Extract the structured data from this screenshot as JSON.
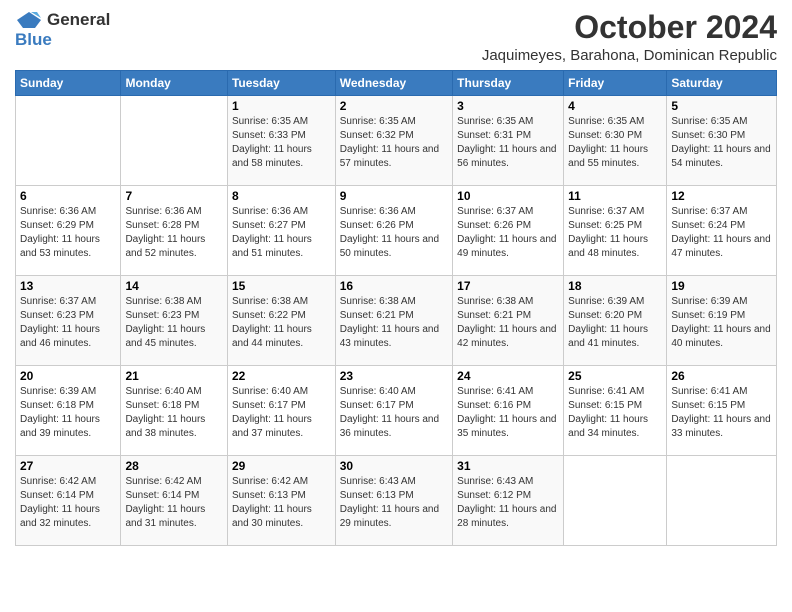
{
  "logo": {
    "general": "General",
    "blue": "Blue"
  },
  "title": {
    "month": "October 2024",
    "location": "Jaquimeyes, Barahona, Dominican Republic"
  },
  "weekdays": [
    "Sunday",
    "Monday",
    "Tuesday",
    "Wednesday",
    "Thursday",
    "Friday",
    "Saturday"
  ],
  "weeks": [
    [
      {
        "day": "",
        "sunrise": "",
        "sunset": "",
        "daylight": ""
      },
      {
        "day": "",
        "sunrise": "",
        "sunset": "",
        "daylight": ""
      },
      {
        "day": "1",
        "sunrise": "Sunrise: 6:35 AM",
        "sunset": "Sunset: 6:33 PM",
        "daylight": "Daylight: 11 hours and 58 minutes."
      },
      {
        "day": "2",
        "sunrise": "Sunrise: 6:35 AM",
        "sunset": "Sunset: 6:32 PM",
        "daylight": "Daylight: 11 hours and 57 minutes."
      },
      {
        "day": "3",
        "sunrise": "Sunrise: 6:35 AM",
        "sunset": "Sunset: 6:31 PM",
        "daylight": "Daylight: 11 hours and 56 minutes."
      },
      {
        "day": "4",
        "sunrise": "Sunrise: 6:35 AM",
        "sunset": "Sunset: 6:30 PM",
        "daylight": "Daylight: 11 hours and 55 minutes."
      },
      {
        "day": "5",
        "sunrise": "Sunrise: 6:35 AM",
        "sunset": "Sunset: 6:30 PM",
        "daylight": "Daylight: 11 hours and 54 minutes."
      }
    ],
    [
      {
        "day": "6",
        "sunrise": "Sunrise: 6:36 AM",
        "sunset": "Sunset: 6:29 PM",
        "daylight": "Daylight: 11 hours and 53 minutes."
      },
      {
        "day": "7",
        "sunrise": "Sunrise: 6:36 AM",
        "sunset": "Sunset: 6:28 PM",
        "daylight": "Daylight: 11 hours and 52 minutes."
      },
      {
        "day": "8",
        "sunrise": "Sunrise: 6:36 AM",
        "sunset": "Sunset: 6:27 PM",
        "daylight": "Daylight: 11 hours and 51 minutes."
      },
      {
        "day": "9",
        "sunrise": "Sunrise: 6:36 AM",
        "sunset": "Sunset: 6:26 PM",
        "daylight": "Daylight: 11 hours and 50 minutes."
      },
      {
        "day": "10",
        "sunrise": "Sunrise: 6:37 AM",
        "sunset": "Sunset: 6:26 PM",
        "daylight": "Daylight: 11 hours and 49 minutes."
      },
      {
        "day": "11",
        "sunrise": "Sunrise: 6:37 AM",
        "sunset": "Sunset: 6:25 PM",
        "daylight": "Daylight: 11 hours and 48 minutes."
      },
      {
        "day": "12",
        "sunrise": "Sunrise: 6:37 AM",
        "sunset": "Sunset: 6:24 PM",
        "daylight": "Daylight: 11 hours and 47 minutes."
      }
    ],
    [
      {
        "day": "13",
        "sunrise": "Sunrise: 6:37 AM",
        "sunset": "Sunset: 6:23 PM",
        "daylight": "Daylight: 11 hours and 46 minutes."
      },
      {
        "day": "14",
        "sunrise": "Sunrise: 6:38 AM",
        "sunset": "Sunset: 6:23 PM",
        "daylight": "Daylight: 11 hours and 45 minutes."
      },
      {
        "day": "15",
        "sunrise": "Sunrise: 6:38 AM",
        "sunset": "Sunset: 6:22 PM",
        "daylight": "Daylight: 11 hours and 44 minutes."
      },
      {
        "day": "16",
        "sunrise": "Sunrise: 6:38 AM",
        "sunset": "Sunset: 6:21 PM",
        "daylight": "Daylight: 11 hours and 43 minutes."
      },
      {
        "day": "17",
        "sunrise": "Sunrise: 6:38 AM",
        "sunset": "Sunset: 6:21 PM",
        "daylight": "Daylight: 11 hours and 42 minutes."
      },
      {
        "day": "18",
        "sunrise": "Sunrise: 6:39 AM",
        "sunset": "Sunset: 6:20 PM",
        "daylight": "Daylight: 11 hours and 41 minutes."
      },
      {
        "day": "19",
        "sunrise": "Sunrise: 6:39 AM",
        "sunset": "Sunset: 6:19 PM",
        "daylight": "Daylight: 11 hours and 40 minutes."
      }
    ],
    [
      {
        "day": "20",
        "sunrise": "Sunrise: 6:39 AM",
        "sunset": "Sunset: 6:18 PM",
        "daylight": "Daylight: 11 hours and 39 minutes."
      },
      {
        "day": "21",
        "sunrise": "Sunrise: 6:40 AM",
        "sunset": "Sunset: 6:18 PM",
        "daylight": "Daylight: 11 hours and 38 minutes."
      },
      {
        "day": "22",
        "sunrise": "Sunrise: 6:40 AM",
        "sunset": "Sunset: 6:17 PM",
        "daylight": "Daylight: 11 hours and 37 minutes."
      },
      {
        "day": "23",
        "sunrise": "Sunrise: 6:40 AM",
        "sunset": "Sunset: 6:17 PM",
        "daylight": "Daylight: 11 hours and 36 minutes."
      },
      {
        "day": "24",
        "sunrise": "Sunrise: 6:41 AM",
        "sunset": "Sunset: 6:16 PM",
        "daylight": "Daylight: 11 hours and 35 minutes."
      },
      {
        "day": "25",
        "sunrise": "Sunrise: 6:41 AM",
        "sunset": "Sunset: 6:15 PM",
        "daylight": "Daylight: 11 hours and 34 minutes."
      },
      {
        "day": "26",
        "sunrise": "Sunrise: 6:41 AM",
        "sunset": "Sunset: 6:15 PM",
        "daylight": "Daylight: 11 hours and 33 minutes."
      }
    ],
    [
      {
        "day": "27",
        "sunrise": "Sunrise: 6:42 AM",
        "sunset": "Sunset: 6:14 PM",
        "daylight": "Daylight: 11 hours and 32 minutes."
      },
      {
        "day": "28",
        "sunrise": "Sunrise: 6:42 AM",
        "sunset": "Sunset: 6:14 PM",
        "daylight": "Daylight: 11 hours and 31 minutes."
      },
      {
        "day": "29",
        "sunrise": "Sunrise: 6:42 AM",
        "sunset": "Sunset: 6:13 PM",
        "daylight": "Daylight: 11 hours and 30 minutes."
      },
      {
        "day": "30",
        "sunrise": "Sunrise: 6:43 AM",
        "sunset": "Sunset: 6:13 PM",
        "daylight": "Daylight: 11 hours and 29 minutes."
      },
      {
        "day": "31",
        "sunrise": "Sunrise: 6:43 AM",
        "sunset": "Sunset: 6:12 PM",
        "daylight": "Daylight: 11 hours and 28 minutes."
      },
      {
        "day": "",
        "sunrise": "",
        "sunset": "",
        "daylight": ""
      },
      {
        "day": "",
        "sunrise": "",
        "sunset": "",
        "daylight": ""
      }
    ]
  ]
}
